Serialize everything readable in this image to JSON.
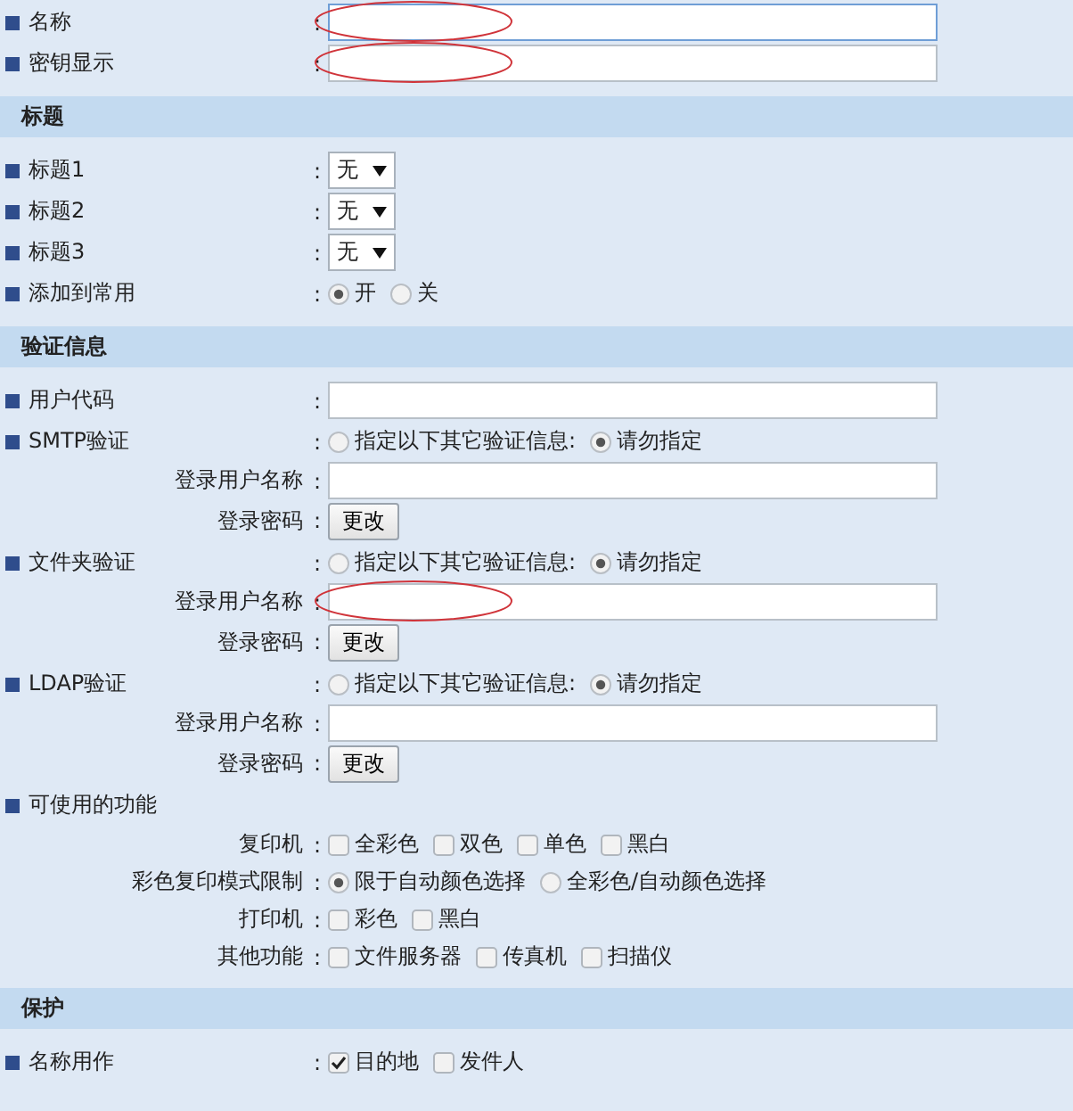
{
  "top_fields": [
    {
      "label": "名称",
      "separator": ":",
      "kind": "input",
      "focused": true,
      "annotated": true
    },
    {
      "label": "密钥显示",
      "separator": ":",
      "kind": "input",
      "focused": false,
      "annotated": true
    }
  ],
  "sections": [
    {
      "title": "标题",
      "rows": [
        {
          "label": "标题1",
          "separator": ":",
          "kind": "select",
          "value": "无"
        },
        {
          "label": "标题2",
          "separator": ":",
          "kind": "select",
          "value": "无"
        },
        {
          "label": "标题3",
          "separator": ":",
          "kind": "select",
          "value": "无"
        },
        {
          "label": "添加到常用",
          "separator": ":",
          "kind": "radio",
          "options": [
            {
              "label": "开",
              "selected": true
            },
            {
              "label": "关",
              "selected": false
            }
          ]
        }
      ]
    },
    {
      "title": "验证信息",
      "rows": [
        {
          "label": "用户代码",
          "separator": ":",
          "kind": "input",
          "focused": false,
          "annotated": false
        },
        {
          "label": "SMTP验证",
          "separator": ":",
          "kind": "radio",
          "options": [
            {
              "label": "指定以下其它验证信息:",
              "selected": false
            },
            {
              "label": "请勿指定",
              "selected": true
            }
          ],
          "children": [
            {
              "label": "登录用户名称",
              "separator": ":",
              "kind": "input",
              "focused": false,
              "annotated": false
            },
            {
              "label": "登录密码",
              "separator": ":",
              "kind": "button",
              "button_label": "更改"
            }
          ]
        },
        {
          "label": "文件夹验证",
          "separator": ":",
          "kind": "radio",
          "options": [
            {
              "label": "指定以下其它验证信息:",
              "selected": false
            },
            {
              "label": "请勿指定",
              "selected": true
            }
          ],
          "children": [
            {
              "label": "登录用户名称",
              "separator": ":",
              "kind": "input",
              "focused": false,
              "annotated": true
            },
            {
              "label": "登录密码",
              "separator": ":",
              "kind": "button",
              "button_label": "更改"
            }
          ]
        },
        {
          "label": "LDAP验证",
          "separator": ":",
          "kind": "radio",
          "options": [
            {
              "label": "指定以下其它验证信息:",
              "selected": false
            },
            {
              "label": "请勿指定",
              "selected": true
            }
          ],
          "children": [
            {
              "label": "登录用户名称",
              "separator": ":",
              "kind": "input",
              "focused": false,
              "annotated": false
            },
            {
              "label": "登录密码",
              "separator": ":",
              "kind": "button",
              "button_label": "更改"
            }
          ]
        },
        {
          "label": "可使用的功能",
          "kind": "none",
          "children": [
            {
              "label": "复印机",
              "separator": ":",
              "kind": "checkbox",
              "options": [
                {
                  "label": "全彩色",
                  "checked": false
                },
                {
                  "label": "双色",
                  "checked": false
                },
                {
                  "label": "单色",
                  "checked": false
                },
                {
                  "label": "黑白",
                  "checked": false
                }
              ]
            },
            {
              "label": "彩色复印模式限制",
              "separator": ":",
              "kind": "radio",
              "options": [
                {
                  "label": "限于自动颜色选择",
                  "selected": true
                },
                {
                  "label": "全彩色/自动颜色选择",
                  "selected": false
                }
              ]
            },
            {
              "label": "打印机",
              "separator": ":",
              "kind": "checkbox",
              "options": [
                {
                  "label": "彩色",
                  "checked": false
                },
                {
                  "label": "黑白",
                  "checked": false
                }
              ]
            },
            {
              "label": "其他功能",
              "separator": ":",
              "kind": "checkbox",
              "options": [
                {
                  "label": "文件服务器",
                  "checked": false
                },
                {
                  "label": "传真机",
                  "checked": false
                },
                {
                  "label": "扫描仪",
                  "checked": false
                }
              ]
            }
          ]
        }
      ]
    },
    {
      "title": "保护",
      "rows": [
        {
          "label": "名称用作",
          "separator": ":",
          "kind": "checkbox",
          "options": [
            {
              "label": "目的地",
              "checked": true
            },
            {
              "label": "发件人",
              "checked": false
            }
          ]
        }
      ]
    }
  ]
}
